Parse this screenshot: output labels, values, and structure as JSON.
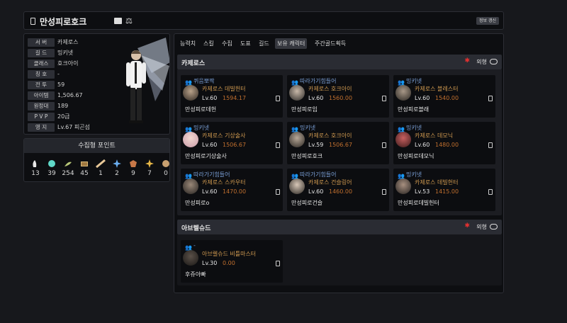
{
  "header": {
    "title": "만성피로호크",
    "refresh_label": "정보 갱신"
  },
  "profile": {
    "rows": [
      {
        "key": "서   버",
        "value": "카제로스"
      },
      {
        "key": "길   드",
        "value": "밍키넷"
      },
      {
        "key": "클래스",
        "value": "호크아이"
      },
      {
        "key": "칭   호",
        "value": "-"
      },
      {
        "key": "전   투",
        "value": "59"
      },
      {
        "key": "아이템",
        "value": "1,506.67"
      },
      {
        "key": "원정대",
        "value": "189"
      },
      {
        "key": "P V P",
        "value": "20급"
      },
      {
        "key": "영   지",
        "value": "Lv.67 피곤섬"
      }
    ]
  },
  "collect": {
    "title": "수집형 포인트",
    "items": [
      {
        "icon": "mokoko-seed-icon",
        "value": "13"
      },
      {
        "icon": "island-heart-icon",
        "value": "39"
      },
      {
        "icon": "giant-heart-icon",
        "value": "254"
      },
      {
        "icon": "art-piece-icon",
        "value": "45"
      },
      {
        "icon": "ignea-token-icon",
        "value": "1"
      },
      {
        "icon": "voyage-star-icon",
        "value": "2"
      },
      {
        "icon": "world-tree-leaf-icon",
        "value": "9"
      },
      {
        "icon": "orpheus-star-icon",
        "value": "7"
      },
      {
        "icon": "medal-icon",
        "value": "0"
      }
    ]
  },
  "tabs": [
    "능력치",
    "스킬",
    "수집",
    "도표",
    "길드",
    "보유 캐릭터",
    "주간골드획득"
  ],
  "active_tab": "보유 캐릭터",
  "sections": [
    {
      "server": "카제로스",
      "exclude_label": "외형",
      "characters": [
        {
          "guild": "퀴음뽀짝",
          "server": "카제로스",
          "class": "데빌헌터",
          "level": "Lv.60",
          "item_level": "1594.17",
          "name": "만성피로데헌"
        },
        {
          "guild": "따라가기힘들어",
          "server": "카제로스",
          "class": "호크아이",
          "level": "Lv.60",
          "item_level": "1560.00",
          "name": "만성피로임"
        },
        {
          "guild": "밍키넷",
          "server": "카제로스",
          "class": "블레스터",
          "level": "Lv.60",
          "item_level": "1540.00",
          "name": "만성피로블래"
        },
        {
          "guild": "밍키넷",
          "server": "카제로스",
          "class": "기상술사",
          "level": "Lv.60",
          "item_level": "1506.67",
          "name": "만성피로기상술사"
        },
        {
          "guild": "밍키넷",
          "server": "카제로스",
          "class": "호크아이",
          "level": "Lv.59",
          "item_level": "1506.67",
          "name": "만성피로호크"
        },
        {
          "guild": "밍키넷",
          "server": "카제로스",
          "class": "데모닉",
          "level": "Lv.60",
          "item_level": "1480.00",
          "name": "만성피로데모닉"
        },
        {
          "guild": "따라가기힘들어",
          "server": "카제로스",
          "class": "스카우터",
          "level": "Lv.60",
          "item_level": "1470.00",
          "name": "만성피로o"
        },
        {
          "guild": "따라가기힘들어",
          "server": "카제로스",
          "class": "건슬링어",
          "level": "Lv.60",
          "item_level": "1460.00",
          "name": "만성피로건슬"
        },
        {
          "guild": "밍키넷",
          "server": "카제로스",
          "class": "데빌헌터",
          "level": "Lv.53",
          "item_level": "1415.00",
          "name": "만성피로데빌헌터"
        }
      ]
    },
    {
      "server": "아브렐슈드",
      "exclude_label": "외형",
      "characters": [
        {
          "guild": "-",
          "server": "아브렐슈드",
          "class": "비틀마스터",
          "level": "Lv.30",
          "item_level": "0.00",
          "name": "후쥬아빠"
        }
      ]
    }
  ],
  "colors": {
    "accent_red": "#e53030",
    "guild_blue": "#7a9fd6",
    "class_orange": "#d19a50",
    "ilvl_orange": "#c06f2e"
  }
}
